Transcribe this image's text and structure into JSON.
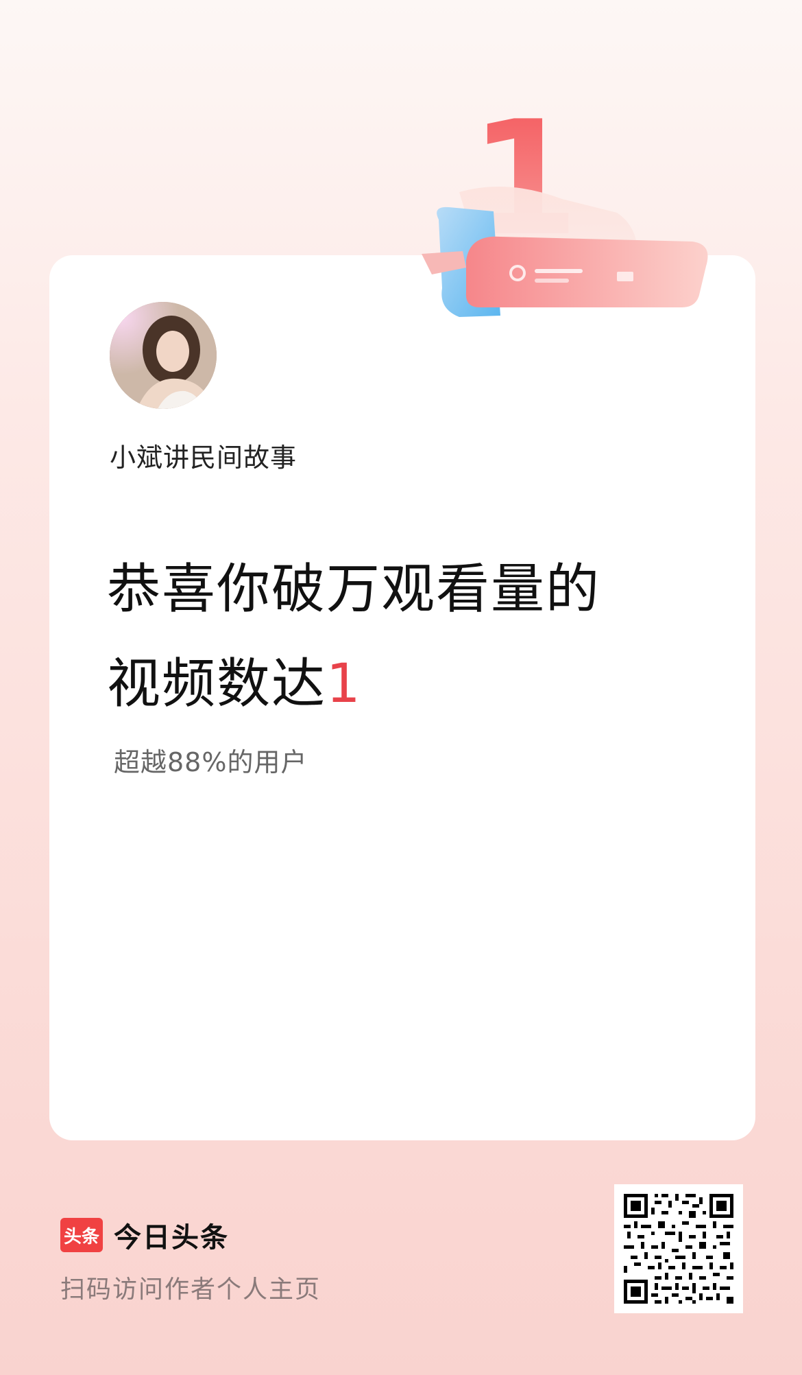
{
  "hero": {
    "number": "1"
  },
  "profile": {
    "author_name": "小斌讲民间故事"
  },
  "headline": {
    "line1": "恭喜你破万观看量的",
    "line2_prefix": "视频数达",
    "count": "1"
  },
  "stats": {
    "subline": "超越88%的用户"
  },
  "footer": {
    "brand_logo_text": "头条",
    "brand_name": "今日头条",
    "scan_hint": "扫码访问作者个人主页"
  },
  "colors": {
    "accent": "#e8424a",
    "brand": "#f04142",
    "background_top": "#fdf7f5",
    "background_bottom": "#f9d3cf"
  },
  "icons": {
    "hero": "scroll-ribbon-icon",
    "qr": "qr-code-icon"
  }
}
